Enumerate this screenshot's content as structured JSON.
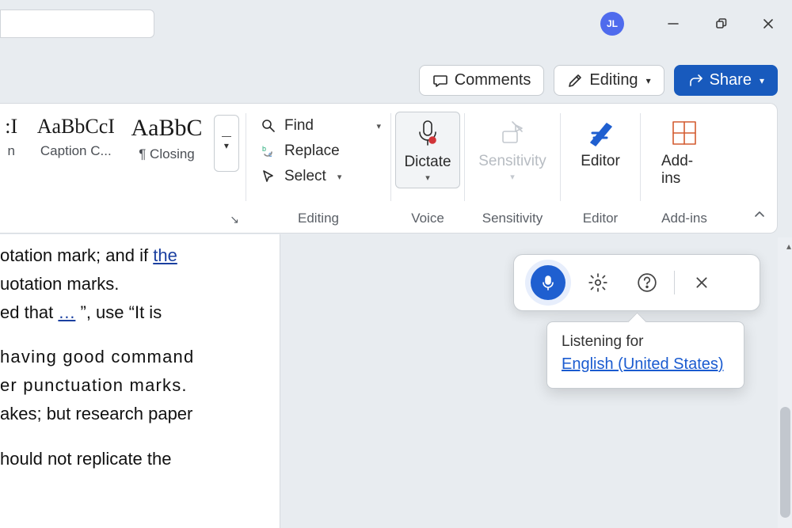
{
  "titlebar": {
    "avatar_initials": "JL"
  },
  "top_actions": {
    "comments": "Comments",
    "editing": "Editing",
    "share": "Share"
  },
  "ribbon": {
    "styles": {
      "item1_preview": ":I",
      "item1_name": "n",
      "item2_preview": "AaBbCcI",
      "item2_name": "Caption C...",
      "item3_preview": "AaBbC",
      "item3_name": "¶ Closing"
    },
    "editing": {
      "find": "Find",
      "replace": "Replace",
      "select": "Select",
      "group_label": "Editing"
    },
    "voice": {
      "dictate": "Dictate",
      "group_label": "Voice"
    },
    "sensitivity": {
      "label": "Sensitivity",
      "group_label": "Sensitivity"
    },
    "editor": {
      "label": "Editor",
      "group_label": "Editor"
    },
    "addins": {
      "label": "Add-ins",
      "group_label": "Add-ins"
    }
  },
  "document": {
    "line1a": "otation mark; and if ",
    "line1b": "the",
    "line2": "uotation marks.",
    "line3a": "ed that ",
    "line3b": "…",
    "line3c": " ”, use “It is",
    "line4": "having good command",
    "line5": "er punctuation marks.",
    "line6": "akes; but research paper",
    "line7": "hould not replicate the"
  },
  "dictation": {
    "listening_label": "Listening for",
    "language": "English (United States)"
  }
}
